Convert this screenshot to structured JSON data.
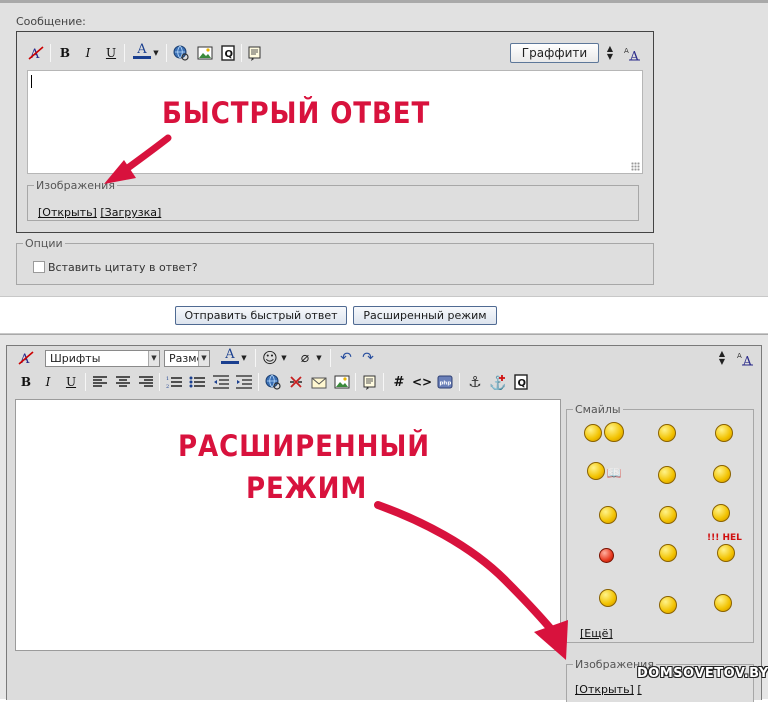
{
  "quick_reply": {
    "message_label": "Сообщение:",
    "toolbar": {
      "bold": "B",
      "italic": "I",
      "underline": "U",
      "font_color": "A",
      "graffiti_label": "Граффити"
    },
    "images": {
      "legend": "Изображения",
      "open_link": "[Открыть]",
      "upload_link": "[Загрузка]"
    },
    "options": {
      "legend": "Опции",
      "quote_checkbox": "Вставить цитату в ответ?"
    }
  },
  "submit": {
    "send_quick": "Отправить быстрый ответ",
    "advanced_mode": "Расширенный режим"
  },
  "advanced": {
    "font_select": "Шрифты",
    "size_select": "Размер",
    "toolbar": {
      "bold": "B",
      "italic": "I",
      "underline": "U",
      "font_color": "A",
      "hash": "#",
      "code": "<>"
    },
    "smilies": {
      "legend": "Смайлы",
      "more_link": "[Ещё]",
      "sign_text": "!!! HEL"
    },
    "images": {
      "legend": "Изображения",
      "open_link": "[Открыть]",
      "bracket": "["
    }
  },
  "annotations": {
    "quick_reply_label": "БЫСТРЫЙ ОТВЕТ",
    "advanced_label_line1": "РАСШИРЕННЫЙ",
    "advanced_label_line2": "РЕЖИМ",
    "watermark": "DOMSOVETOV.BY"
  },
  "colors": {
    "annotation_red": "#d8123d",
    "panel_gray": "#dddddd",
    "button_border": "#4f6a92"
  }
}
